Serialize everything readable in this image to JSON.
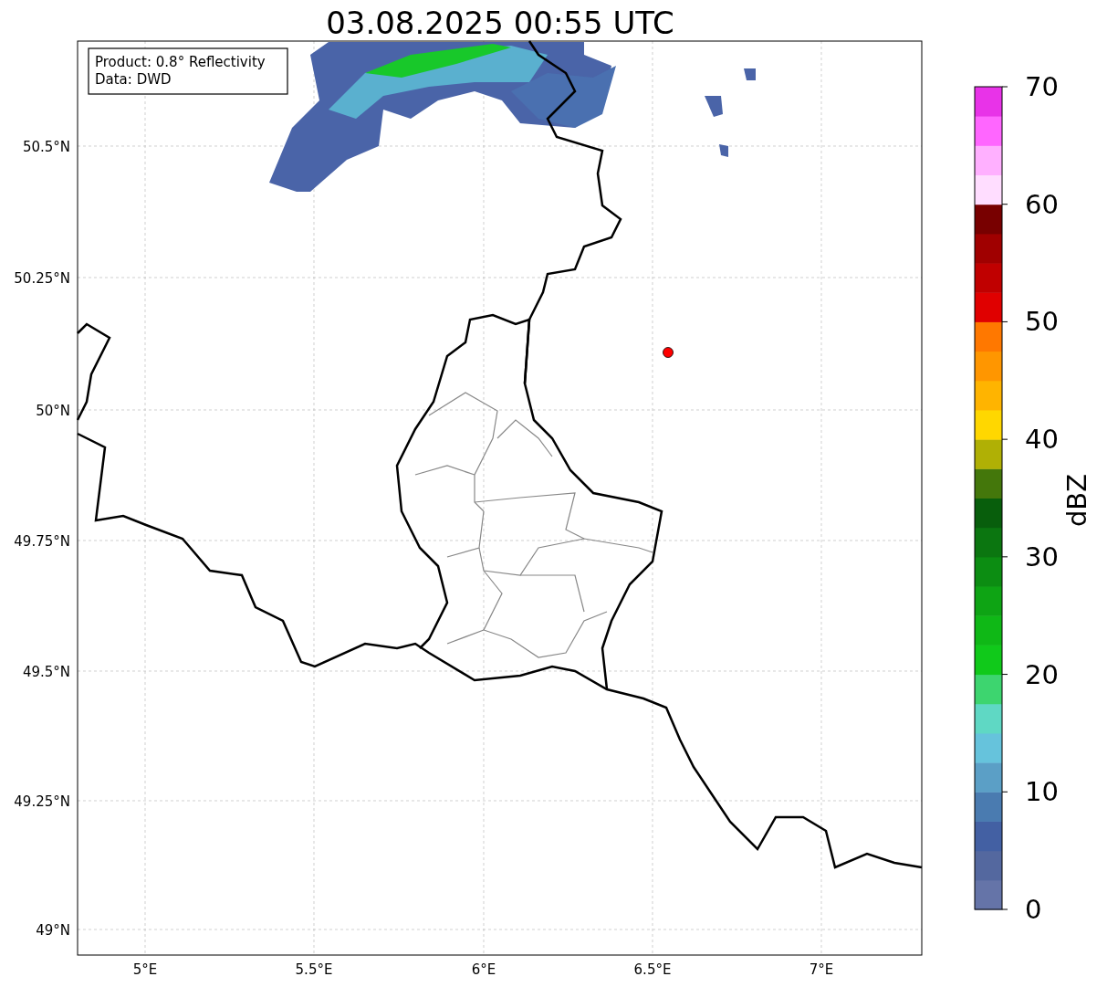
{
  "title": "03.08.2025 00:55 UTC",
  "info_box": [
    "Product: 0.8° Reflectivity",
    "Data: DWD"
  ],
  "y_axis": {
    "ticks": [
      "50.5°N",
      "50.25°N",
      "50°N",
      "49.75°N",
      "49.5°N",
      "49.25°N",
      "49°N"
    ]
  },
  "x_axis": {
    "ticks": [
      "5°E",
      "5.5°E",
      "6°E",
      "6.5°E",
      "7°E"
    ]
  },
  "colorbar": {
    "label": "dBZ",
    "ticks": [
      "70",
      "60",
      "50",
      "40",
      "30",
      "20",
      "10",
      "0"
    ],
    "bands": [
      {
        "color": "#6574a8"
      },
      {
        "color": "#54689f"
      },
      {
        "color": "#4360a3"
      },
      {
        "color": "#4a7bb0"
      },
      {
        "color": "#5b9fc6"
      },
      {
        "color": "#66c3dc"
      },
      {
        "color": "#5fd8c4"
      },
      {
        "color": "#3dd56f"
      },
      {
        "color": "#10c91a"
      },
      {
        "color": "#0fb816"
      },
      {
        "color": "#0ea414"
      },
      {
        "color": "#0c8d12"
      },
      {
        "color": "#0b7610"
      },
      {
        "color": "#085e0c"
      },
      {
        "color": "#44770b"
      },
      {
        "color": "#b0b005"
      },
      {
        "color": "#ffd700"
      },
      {
        "color": "#ffb400"
      },
      {
        "color": "#ff9600"
      },
      {
        "color": "#ff7800"
      },
      {
        "color": "#e00000"
      },
      {
        "color": "#c00000"
      },
      {
        "color": "#a00000"
      },
      {
        "color": "#780000"
      },
      {
        "color": "#ffddff"
      },
      {
        "color": "#ffb0ff"
      },
      {
        "color": "#ff66ff"
      },
      {
        "color": "#e833e8"
      }
    ]
  }
}
